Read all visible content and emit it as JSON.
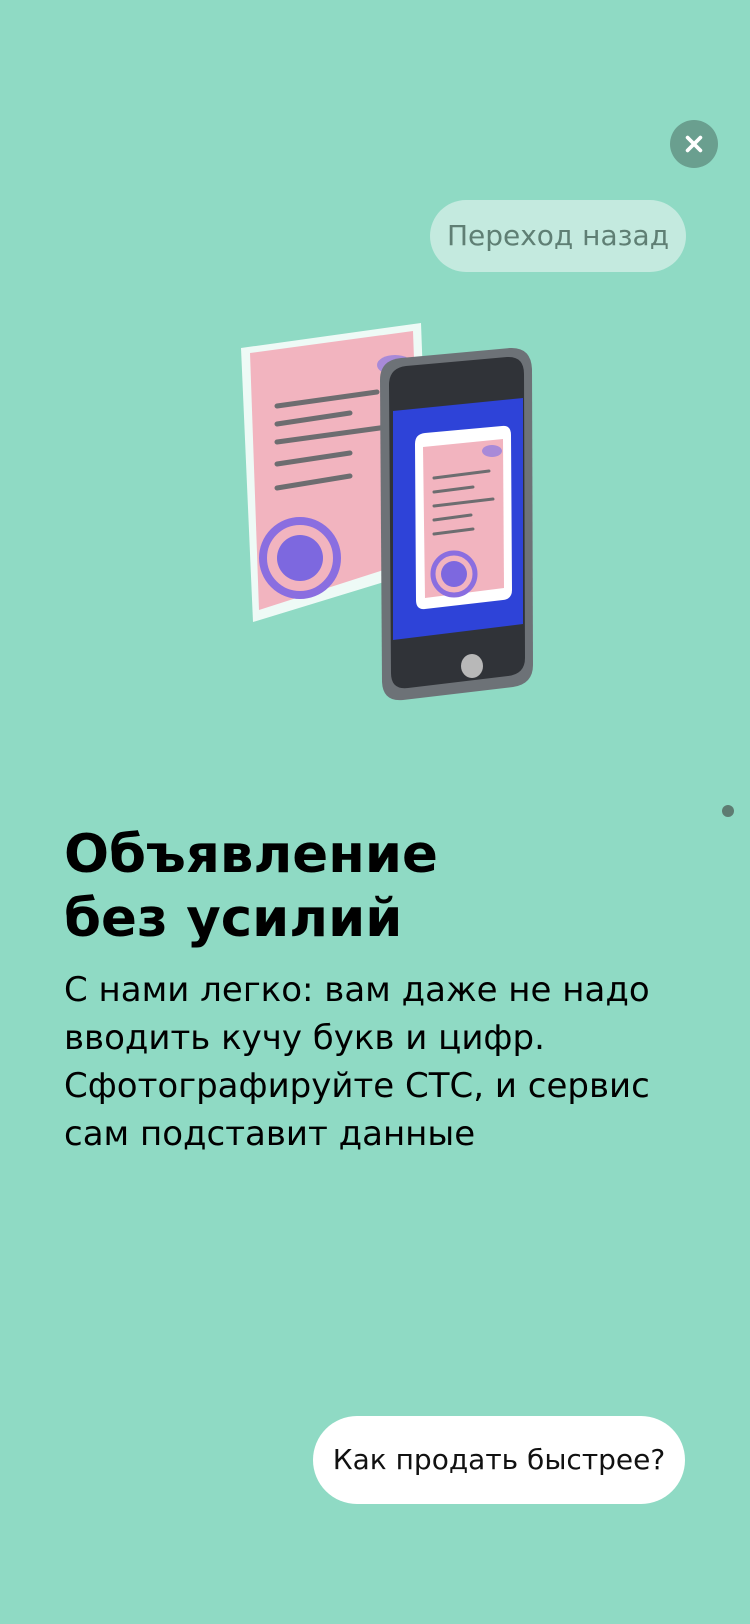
{
  "header": {
    "close_icon": "close-icon",
    "back_label": "Переход назад"
  },
  "illustration": {
    "name": "document-and-phone-illustration",
    "colors": {
      "background": "#8fdac4",
      "document": "#f2b4bf",
      "phone_body": "#3a3d42",
      "phone_screen": "#2e43d8",
      "stamp": "#7d68df"
    }
  },
  "content": {
    "title_line_1": "Объявление",
    "title_line_2": "без усилий",
    "description_lines": [
      "С нами легко: вам даже не надо",
      "вводить кучу букв и цифр.",
      "Сфотографируйте СТС, и сервис",
      "сам подставит данные"
    ]
  },
  "footer": {
    "cta_label": "Как продать быстрее?"
  },
  "colors": {
    "background": "#8fdac4",
    "close_button": "#6a9f8f",
    "back_chip": "#c4eadf",
    "cta_background": "#ffffff"
  }
}
